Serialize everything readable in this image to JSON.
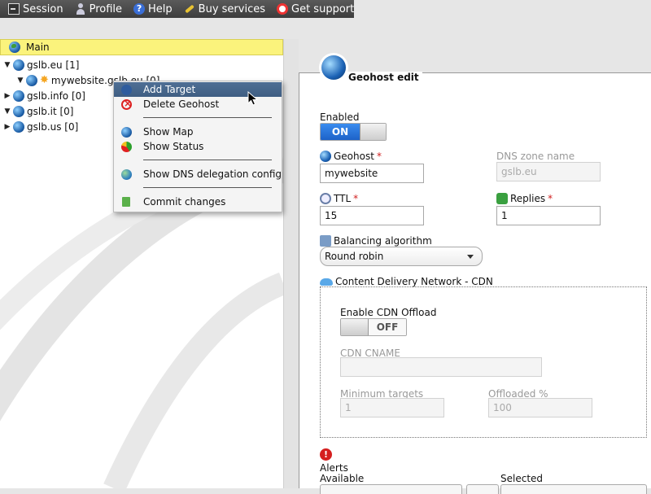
{
  "toolbar": {
    "items": [
      {
        "label": "Session",
        "icon": "terminal-icon"
      },
      {
        "label": "Profile",
        "icon": "user-icon"
      },
      {
        "label": "Help",
        "icon": "help-icon"
      },
      {
        "label": "Buy services",
        "icon": "wand-icon"
      },
      {
        "label": "Get support",
        "icon": "lifebuoy-icon"
      }
    ]
  },
  "tree": {
    "header": "Main",
    "nodes": [
      {
        "label": "gslb.eu [1]",
        "expander": "▼"
      },
      {
        "label": "mywebsite.gslb.eu [0]",
        "expander": "▼"
      },
      {
        "label": "gslb.info [0]",
        "expander": "▶"
      },
      {
        "label": "gslb.it [0]",
        "expander": "▼"
      },
      {
        "label": "gslb.us [0]",
        "expander": "▶"
      }
    ]
  },
  "context_menu": {
    "items": [
      {
        "label": "Add Target",
        "highlighted": true
      },
      {
        "label": "Delete Geohost"
      },
      {
        "label": "Show Map"
      },
      {
        "label": "Show Status"
      },
      {
        "label": "Show DNS delegation config"
      },
      {
        "label": "Commit changes"
      }
    ]
  },
  "form": {
    "title": "Geohost edit",
    "enabled_label": "Enabled",
    "enabled_value": "ON",
    "geohost_label": "Geohost",
    "geohost_value": "mywebsite",
    "dns_zone_label": "DNS zone name",
    "dns_zone_value": "gslb.eu",
    "ttl_label": "TTL",
    "ttl_value": "15",
    "replies_label": "Replies",
    "replies_value": "1",
    "required_mark": "*",
    "balancing_label": "Balancing algorithm",
    "balancing_value": "Round robin",
    "cdn_label": "Content Delivery Network - CDN",
    "cdn_offload_label": "Enable CDN Offload",
    "cdn_offload_value": "OFF",
    "cdn_cname_label": "CDN CNAME",
    "cdn_cname_value": "",
    "min_targets_label": "Minimum targets",
    "min_targets_value": "1",
    "offloaded_label": "Offloaded %",
    "offloaded_value": "100",
    "alerts_label": "Alerts",
    "alert_mark": "!",
    "available_label": "Available",
    "selected_label": "Selected"
  },
  "colors": {
    "toolbar_bg": "#4a4a4a",
    "tree_header_bg": "#fbf37c",
    "menu_highlight": "#4a6a90",
    "toggle_on": "#2a74dc",
    "required": "#d02020"
  }
}
